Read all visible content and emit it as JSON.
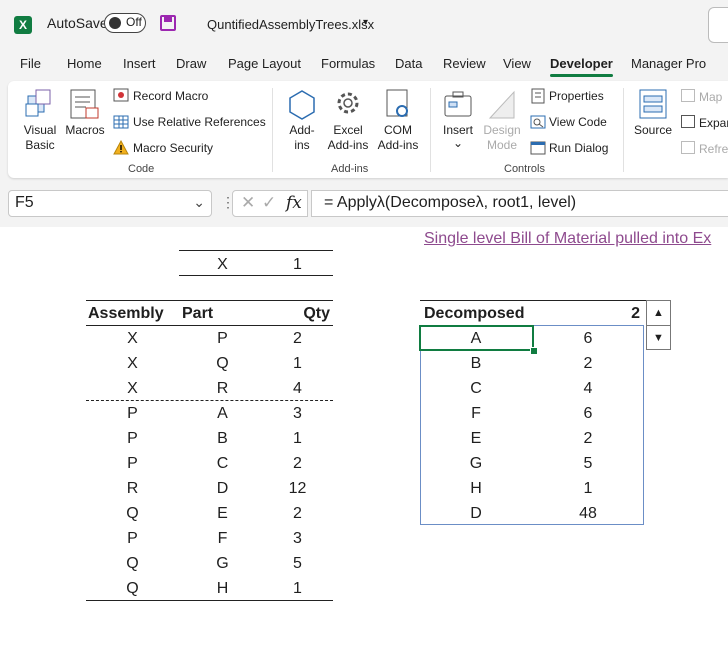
{
  "titlebar": {
    "autosave_label": "AutoSave",
    "autosave_state": "Off",
    "file_name": "QuntifiedAssemblyTrees.xlsx"
  },
  "tabs": [
    "File",
    "Home",
    "Insert",
    "Draw",
    "Page Layout",
    "Formulas",
    "Data",
    "Review",
    "View",
    "Developer",
    "Manager Pro"
  ],
  "active_tab": "Developer",
  "ribbon": {
    "code": {
      "visual_basic": [
        "Visual",
        "Basic"
      ],
      "macros": "Macros",
      "record_macro": "Record Macro",
      "relative_refs": "Use Relative References",
      "macro_security": "Macro Security",
      "group_label": "Code"
    },
    "addins": {
      "addins": [
        "Add-",
        "ins"
      ],
      "excel_addins": [
        "Excel",
        "Add-ins"
      ],
      "com_addins": [
        "COM",
        "Add-ins"
      ],
      "group_label": "Add-ins"
    },
    "controls": {
      "insert": "Insert",
      "design_mode": [
        "Design",
        "Mode"
      ],
      "properties": "Properties",
      "view_code": "View Code",
      "run_dialog": "Run Dialog",
      "group_label": "Controls"
    },
    "xml": {
      "source": "Source",
      "map_properties": "Map",
      "expansion_packs": "Expar",
      "refresh_data": "Refre"
    }
  },
  "formula_bar": {
    "name_box": "F5",
    "formula": "= Applyλ(Decomposeλ, root1, level)"
  },
  "sheet": {
    "root": {
      "name": "X",
      "qty": "1"
    },
    "link_text": "Single level Bill of Material pulled into Ex",
    "bom_headers": [
      "Assembly",
      "Part",
      "Qty"
    ],
    "bom_rows": [
      [
        "X",
        "P",
        "2"
      ],
      [
        "X",
        "Q",
        "1"
      ],
      [
        "X",
        "R",
        "4"
      ],
      [
        "P",
        "A",
        "3"
      ],
      [
        "P",
        "B",
        "1"
      ],
      [
        "P",
        "C",
        "2"
      ],
      [
        "R",
        "D",
        "12"
      ],
      [
        "Q",
        "E",
        "2"
      ],
      [
        "P",
        "F",
        "3"
      ],
      [
        "Q",
        "G",
        "5"
      ],
      [
        "Q",
        "H",
        "1"
      ]
    ],
    "decomposed_label": "Decomposed",
    "level": "2",
    "decomposed_rows": [
      [
        "A",
        "6"
      ],
      [
        "B",
        "2"
      ],
      [
        "C",
        "4"
      ],
      [
        "F",
        "6"
      ],
      [
        "E",
        "2"
      ],
      [
        "G",
        "5"
      ],
      [
        "H",
        "1"
      ],
      [
        "D",
        "48"
      ]
    ]
  }
}
